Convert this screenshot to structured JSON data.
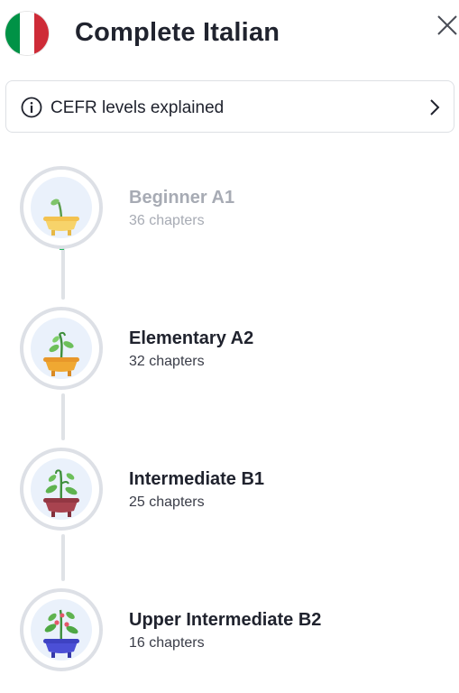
{
  "header": {
    "title": "Complete Italian",
    "flag_colors": [
      "#009246",
      "#ffffff",
      "#ce2b37"
    ]
  },
  "cefr": {
    "label": "CEFR levels explained"
  },
  "levels": [
    {
      "name": "Beginner A1",
      "chapters": "36 chapters",
      "pot_color": "#f7d36a",
      "state": "completed"
    },
    {
      "name": "Elementary A2",
      "chapters": "32 chapters",
      "pot_color": "#f0a832",
      "state": "active"
    },
    {
      "name": "Intermediate B1",
      "chapters": "25 chapters",
      "pot_color": "#a8434f",
      "state": "active"
    },
    {
      "name": "Upper Intermediate B2",
      "chapters": "16 chapters",
      "pot_color": "#4b4fd6",
      "state": "active"
    }
  ],
  "colors": {
    "progress": "#1fb85e",
    "connector": "#dfe2e6"
  },
  "icons": [
    "italy-flag-icon",
    "close-icon",
    "info-icon",
    "chevron-right-icon",
    "plant-pot-icon"
  ]
}
